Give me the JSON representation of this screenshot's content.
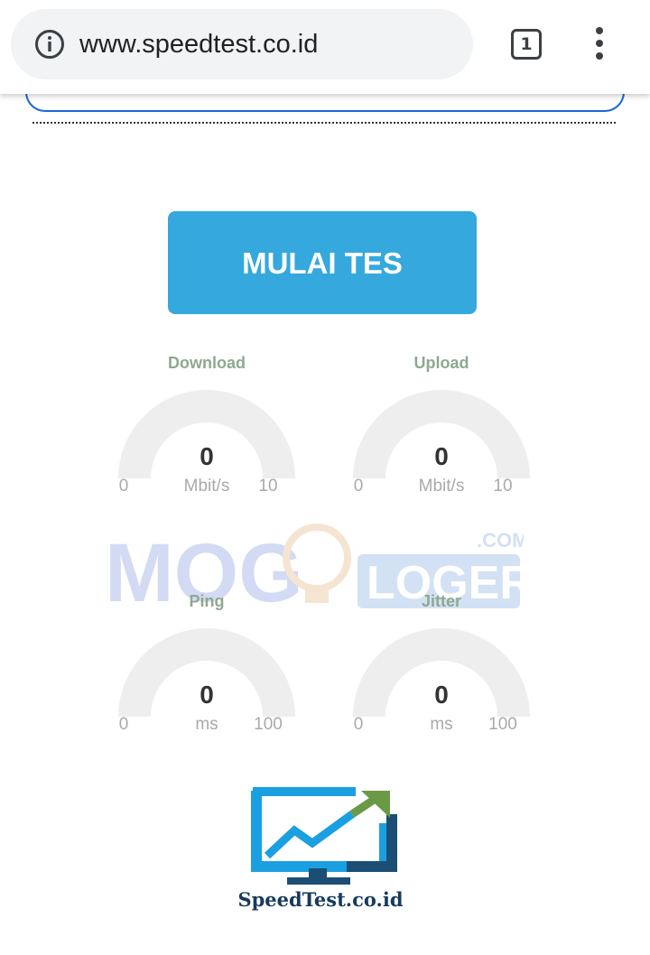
{
  "browser": {
    "url": "www.speedtest.co.id",
    "tab_count": "1",
    "icons": {
      "info": "info-icon",
      "tabs": "tabs-icon",
      "menu": "more-vert-icon"
    }
  },
  "main": {
    "start_label": "MULAI TES"
  },
  "watermark": {
    "text_left": "MOG",
    "text_right": "LOGER",
    "suffix": ".COM"
  },
  "gauges": {
    "download": {
      "title": "Download",
      "value": "0",
      "min": "0",
      "unit": "Mbit/s",
      "max": "10"
    },
    "upload": {
      "title": "Upload",
      "value": "0",
      "min": "0",
      "unit": "Mbit/s",
      "max": "10"
    },
    "ping": {
      "title": "Ping",
      "value": "0",
      "min": "0",
      "unit": "ms",
      "max": "100"
    },
    "jitter": {
      "title": "Jitter",
      "value": "0",
      "min": "0",
      "unit": "ms",
      "max": "100"
    }
  },
  "logo": {
    "text": "SpeedTest.co.id"
  },
  "colors": {
    "accent_button": "#35a8dd",
    "gauge_track": "#eeeeee",
    "gauge_title": "#8fa88f",
    "logo_blue": "#1aa0e0",
    "logo_dark": "#1c4e75",
    "logo_arrow": "#6a9a45"
  }
}
